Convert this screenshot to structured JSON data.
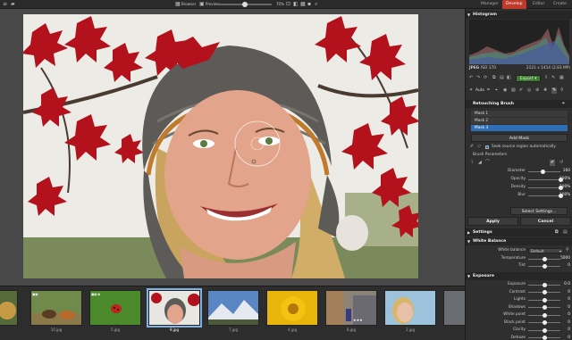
{
  "toolbar": {
    "browser_label": "Browser",
    "preview_label": "Preview",
    "zoom": "70%",
    "zoom_fraction": 0.5
  },
  "modes": {
    "manager": "Manager",
    "develop": "Develop",
    "editor": "Editor",
    "create": "Create"
  },
  "histogram": {
    "title": "Histogram",
    "format": "JPEG",
    "iso": "ISO 170",
    "dimensions": "2121 x 1414 (2.83 MP)"
  },
  "quick": {
    "export_label": "Export",
    "auto_label": "Auto"
  },
  "retouch": {
    "title": "Retouching Brush",
    "masks": [
      "Mask 1",
      "Mask 2",
      "Mask 3"
    ],
    "active_mask_index": 2,
    "add_mask": "Add Mask",
    "auto_source": "Seek source region automatically",
    "brush_params": "Brush Parameters",
    "params": [
      {
        "label": "Diameter",
        "value": "160",
        "fraction": 0.45
      },
      {
        "label": "Opacity",
        "value": "100%",
        "fraction": 1.0
      },
      {
        "label": "Density",
        "value": "100%",
        "fraction": 1.0
      },
      {
        "label": "Blur",
        "value": "100%",
        "fraction": 1.0
      }
    ],
    "select_settings": "Select Settings..."
  },
  "actions": {
    "apply": "Apply",
    "cancel": "Cancel"
  },
  "settings": {
    "title": "Settings"
  },
  "white_balance": {
    "title": "White Balance",
    "preset_label": "White balance",
    "preset_value": "Default",
    "params": [
      {
        "label": "Temperature",
        "value": "5000",
        "fraction": 0.5
      },
      {
        "label": "Tint",
        "value": "0",
        "fraction": 0.5
      }
    ]
  },
  "exposure": {
    "title": "Exposure",
    "params": [
      {
        "label": "Exposure",
        "value": "0.0",
        "fraction": 0.5
      },
      {
        "label": "Contrast",
        "value": "0",
        "fraction": 0.5
      },
      {
        "label": "Lights",
        "value": "0",
        "fraction": 0.5
      },
      {
        "label": "Shadows",
        "value": "0",
        "fraction": 0.5
      },
      {
        "label": "White point",
        "value": "0",
        "fraction": 0.5
      },
      {
        "label": "Black point",
        "value": "0",
        "fraction": 0.5
      },
      {
        "label": "Clarity",
        "value": "0",
        "fraction": 0.5
      },
      {
        "label": "Dehaze",
        "value": "0",
        "fraction": 0.5
      }
    ]
  },
  "filmstrip": {
    "items": [
      {
        "caption": "",
        "scene": "partial"
      },
      {
        "caption": "10.jpg",
        "scene": "animals"
      },
      {
        "caption": "5.jpg",
        "scene": "ladybug"
      },
      {
        "caption": "9.jpg",
        "scene": "woman"
      },
      {
        "caption": "7.jpg",
        "scene": "mountains"
      },
      {
        "caption": "4.jpg",
        "scene": "flower"
      },
      {
        "caption": "8.jpg",
        "scene": "street"
      },
      {
        "caption": "2.jpg",
        "scene": "portrait"
      },
      {
        "caption": "",
        "scene": "partial"
      }
    ],
    "selected_index": 3
  },
  "colors": {
    "accent": "#c0392b",
    "mask_active": "#2e6fb5",
    "panel_bg": "#2f2f2f"
  }
}
